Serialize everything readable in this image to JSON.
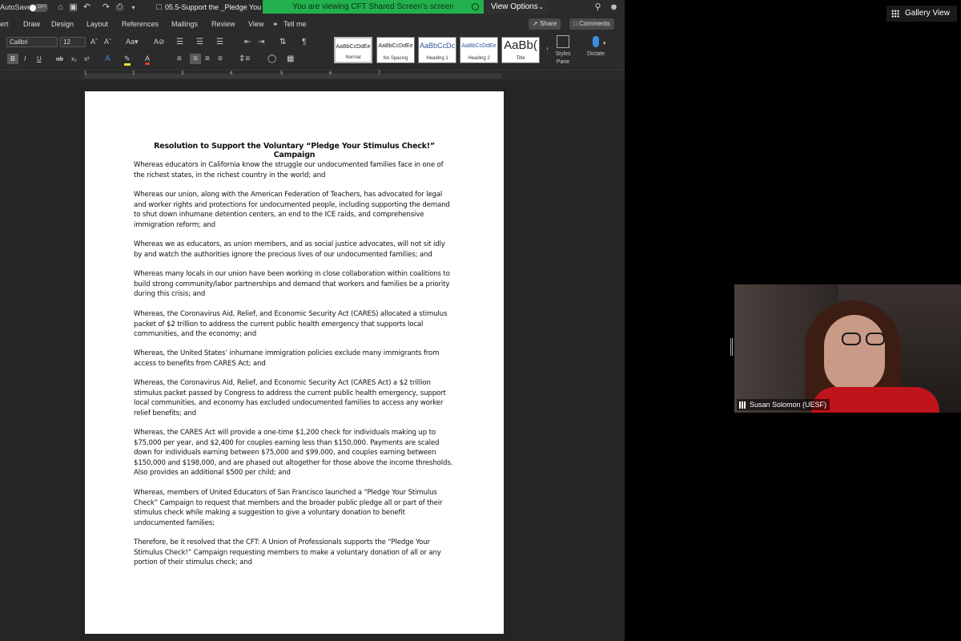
{
  "titlebar": {
    "autosave_label": "AutoSave",
    "autosave_state": "OFF",
    "doc_title": "05.5-Support the _Pledge You"
  },
  "zoom": {
    "share_banner": "You are viewing CFT Shared Screen's screen",
    "view_options": "View Options",
    "gallery_view": "Gallery View",
    "participant_name": "Susan Solomon (UESF)"
  },
  "tabs": {
    "items": [
      "ert",
      "Draw",
      "Design",
      "Layout",
      "References",
      "Mailings",
      "Review",
      "View"
    ],
    "tell_me": "Tell me",
    "share": "Share",
    "comments": "Comments"
  },
  "ribbon": {
    "font": "Calibri",
    "font_size": "12",
    "styles": [
      {
        "preview": "AaBbCcDdEe",
        "name": "Normal"
      },
      {
        "preview": "AaBbCcDdEe",
        "name": "No Spacing"
      },
      {
        "preview": "AaBbCcDc",
        "name": "Heading 1"
      },
      {
        "preview": "AaBbCcDdEe",
        "name": "Heading 2"
      },
      {
        "preview": "AaBb(",
        "name": "Title"
      }
    ],
    "styles_pane": "Styles\nPane",
    "dictate": "Dictate"
  },
  "ruler": [
    "1",
    "2",
    "3",
    "4",
    "5",
    "6",
    "7"
  ],
  "document": {
    "title": "Resolution to Support the Voluntary “Pledge Your Stimulus Check!” Campaign",
    "paragraphs": [
      "Whereas educators in California know the struggle our undocumented families face in one of the richest states, in the richest country in the world; and",
      "Whereas our union, along with the American Federation of Teachers, has advocated for legal and worker rights and protections for undocumented people, including supporting the demand to shut down inhumane detention centers, an end to the ICE raids, and comprehensive immigration reform; and",
      "Whereas we as educators, as union members, and as social justice advocates, will not sit idly by and watch the authorities ignore the precious lives of our undocumented families; and",
      "Whereas many locals in our union have been working in close collaboration within coalitions to build strong community/labor partnerships and demand that workers and families be a priority during this crisis; and",
      "Whereas, the Coronavirus Aid, Relief, and Economic Security Act (CARES) allocated a stimulus packet of $2 trillion to address the current public health emergency that supports local communities, and the economy; and",
      "Whereas, the United States’ inhumane immigration policies exclude many immigrants from access to benefits from CARES Act; and",
      "Whereas, the Coronavirus Aid, Relief, and Economic Security Act (CARES Act) a $2 trillion stimulus packet passed by Congress to address the current public health emergency, support local communities, and economy has excluded undocumented families to access any worker relief benefits; and",
      "Whereas, the CARES Act will provide a one-time $1,200 check for individuals making up to $75,000 per year, and $2,400 for couples earning less than $150,000. Payments are scaled down for individuals earning between $75,000 and $99,000, and couples earning between $150,000 and $198,000, and are phased out altogether for those above the income thresholds. Also provides an additional $500 per child; and",
      "Whereas, members of United Educators of San Francisco launched a “Pledge Your Stimulus Check” Campaign to request that members and the broader public pledge all or part of their stimulus check while making a suggestion to give a voluntary donation to benefit undocumented families;",
      "Therefore, be it resolved that the CFT: A Union of Professionals supports the “Pledge Your Stimulus Check!” Campaign requesting members to make a voluntary donation of all or any portion of their stimulus check; and"
    ]
  }
}
